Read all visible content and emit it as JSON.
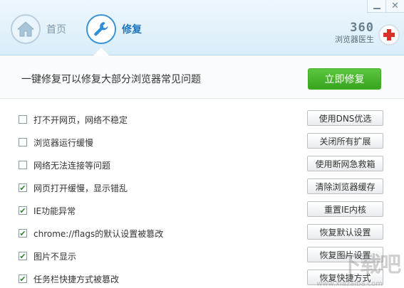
{
  "nav": {
    "home_label": "首页",
    "repair_label": "修复"
  },
  "brand": {
    "number": "360",
    "name": "浏览器医生"
  },
  "action": {
    "headline": "一键修复可以修复大部分浏览器常见问题",
    "fix_button": "立即修复",
    "accent_color": "#3fae25"
  },
  "issues": [
    {
      "label": "打不开网页，网络不稳定",
      "checked": false,
      "button": "使用DNS优选"
    },
    {
      "label": "浏览器运行缓慢",
      "checked": false,
      "button": "关闭所有扩展"
    },
    {
      "label": "网络无法连接等问题",
      "checked": false,
      "button": "使用断网急救箱"
    },
    {
      "label": "网页打开缓慢，显示错乱",
      "checked": true,
      "button": "清除浏览器缓存"
    },
    {
      "label": "IE功能异常",
      "checked": true,
      "button": "重置IE内核"
    },
    {
      "label": "chrome://flags的默认设置被篡改",
      "checked": true,
      "button": "恢复默认设置"
    },
    {
      "label": "图片不显示",
      "checked": true,
      "button": "恢复图片设置"
    },
    {
      "label": "任务栏快捷方式被篡改",
      "checked": true,
      "button": "恢复快捷方式"
    }
  ],
  "watermark": {
    "text": "下载吧",
    "sub": "www.xiazaiba.com"
  }
}
